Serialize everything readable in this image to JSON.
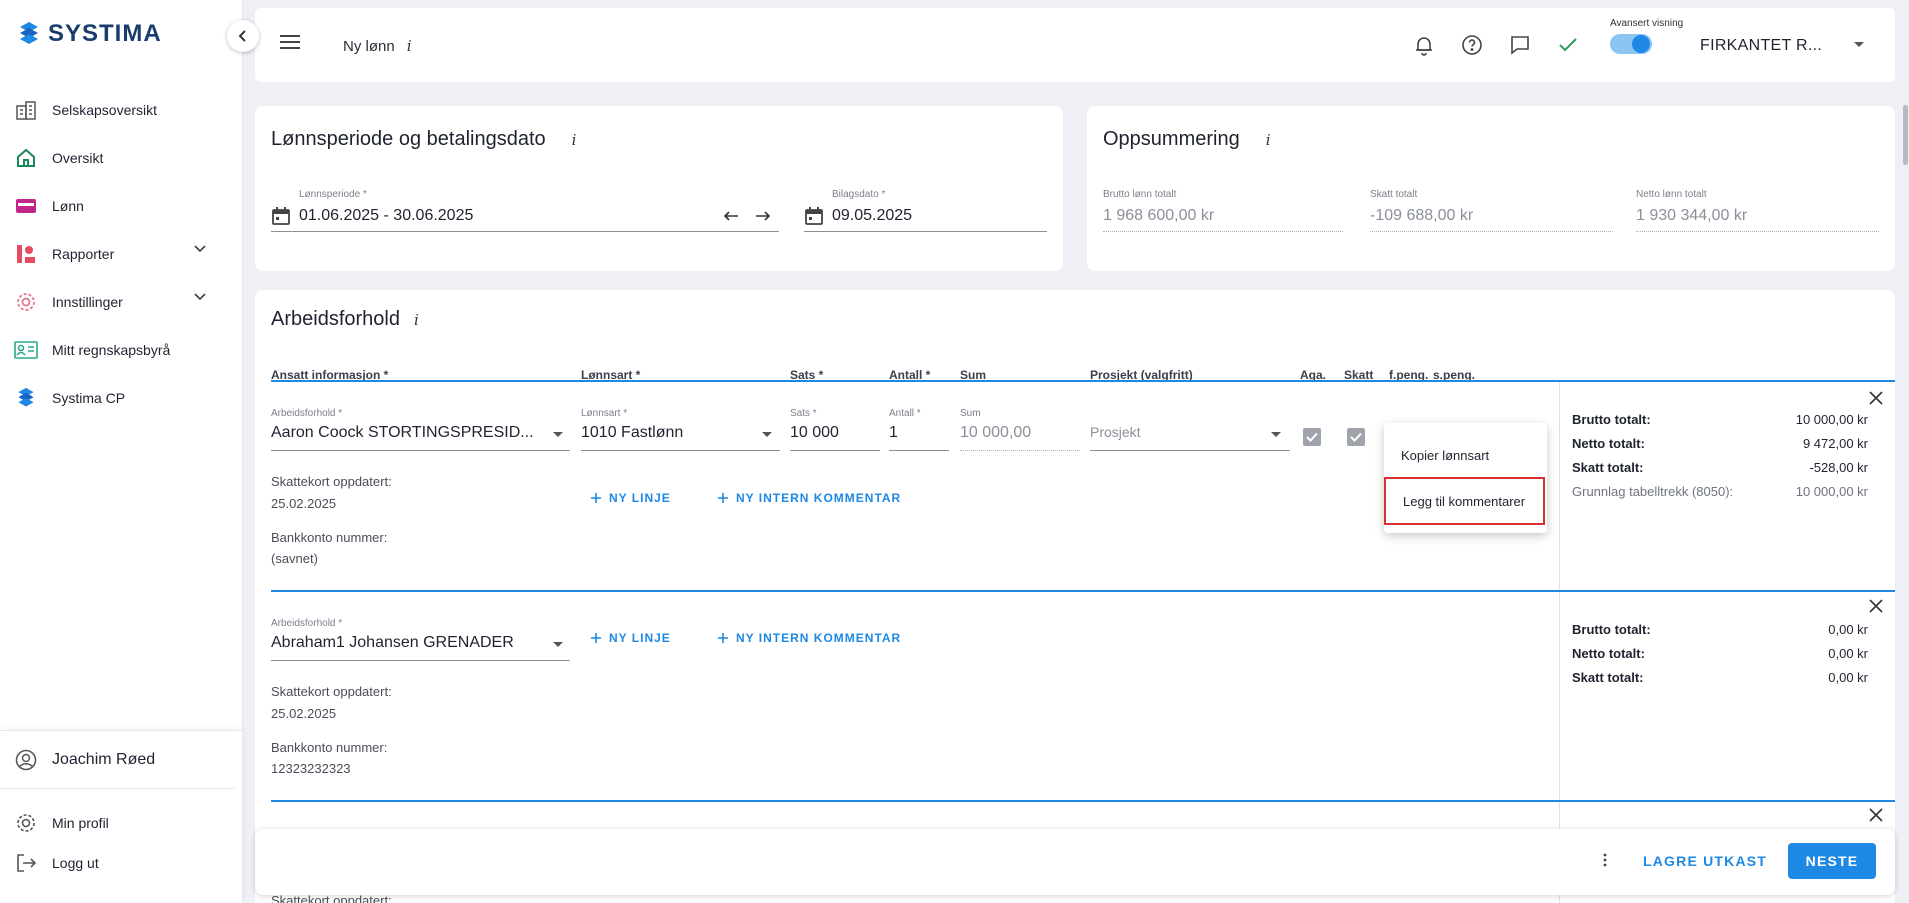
{
  "brand": {
    "name": "SYSTIMA"
  },
  "sidebar": {
    "items": [
      {
        "label": "Selskapsoversikt",
        "icon": "building-icon"
      },
      {
        "label": "Oversikt",
        "icon": "home-icon"
      },
      {
        "label": "Lønn",
        "icon": "card-icon"
      },
      {
        "label": "Rapporter",
        "icon": "report-icon"
      },
      {
        "label": "Innstillinger",
        "icon": "gear-icon"
      },
      {
        "label": "Mitt regnskapsbyrå",
        "icon": "id-card-icon"
      },
      {
        "label": "Systima CP",
        "icon": "systima-logo-icon"
      }
    ],
    "user": "Joachim Røed",
    "profile": "Min profil",
    "logout": "Logg ut"
  },
  "topbar": {
    "title": "Ny lønn",
    "info": "i",
    "toggle_label": "Avansert visning",
    "toggle_on": true,
    "company": "FIRKANTET R..."
  },
  "period_card": {
    "title": "Lønnsperiode og betalingsdato",
    "info": "i",
    "period_label": "Lønnsperiode *",
    "period_value": "01.06.2025 - 30.06.2025",
    "date_label": "Bilagsdato *",
    "date_value": "09.05.2025"
  },
  "summary_card": {
    "title": "Oppsummering",
    "info": "i",
    "gross_label": "Brutto lønn totalt",
    "gross_value": "1 968 600,00 kr",
    "tax_label": "Skatt totalt",
    "tax_value": "-109 688,00 kr",
    "net_label": "Netto lønn totalt",
    "net_value": "1 930 344,00 kr"
  },
  "employment": {
    "title": "Arbeidsforhold",
    "info": "i",
    "columns": [
      "Ansatt informasjon *",
      "Lønnsart *",
      "Sats *",
      "Antall *",
      "Sum",
      "Prosjekt (valgfritt)",
      "Aga.",
      "Skatt",
      "f.peng.",
      "s.peng."
    ],
    "rows": [
      {
        "emp_label": "Arbeidsforhold *",
        "employee": "Aaron Coock STORTINGSPRESID...",
        "wage_label": "Lønnsart *",
        "wage_type": "1010 Fastlønn",
        "rate_label": "Sats *",
        "rate": "10 000",
        "qty_label": "Antall *",
        "qty": "1",
        "sum_label": "Sum",
        "sum": "10 000,00",
        "project_placeholder": "Prosjekt",
        "taxcard_label": "Skattekort oppdatert:",
        "taxcard_date": "25.02.2025",
        "bank_label": "Bankkonto nummer:",
        "bank_value": "(savnet)",
        "add_line": "NY LINJE",
        "add_comment": "NY INTERN KOMMENTAR",
        "totals": [
          {
            "k": "Brutto totalt:",
            "v": "10 000,00 kr"
          },
          {
            "k": "Netto totalt:",
            "v": "9 472,00 kr"
          },
          {
            "k": "Skatt totalt:",
            "v": "-528,00 kr"
          },
          {
            "k": "Grunnlag tabelltrekk (8050):",
            "v": "10 000,00 kr"
          }
        ]
      },
      {
        "emp_label": "Arbeidsforhold *",
        "employee": "Abraham1 Johansen GRENADER",
        "taxcard_label": "Skattekort oppdatert:",
        "taxcard_date": "25.02.2025",
        "bank_label": "Bankkonto nummer:",
        "bank_value": "12323232323",
        "add_line": "NY LINJE",
        "add_comment": "NY INTERN KOMMENTAR",
        "totals": [
          {
            "k": "Brutto totalt:",
            "v": "0,00 kr"
          },
          {
            "k": "Netto totalt:",
            "v": "0,00 kr"
          },
          {
            "k": "Skatt totalt:",
            "v": "0,00 kr"
          }
        ]
      }
    ],
    "next_row_peek": "Skattekort oppdatert:"
  },
  "context_menu": {
    "items": [
      "Kopier lønnsart",
      "Legg til kommentarer"
    ]
  },
  "bottombar": {
    "save_draft": "LAGRE UTKAST",
    "next": "NESTE"
  },
  "colors": {
    "accent": "#1e88e5",
    "highlight": "#d93030",
    "brand": "#1b3d6e"
  }
}
